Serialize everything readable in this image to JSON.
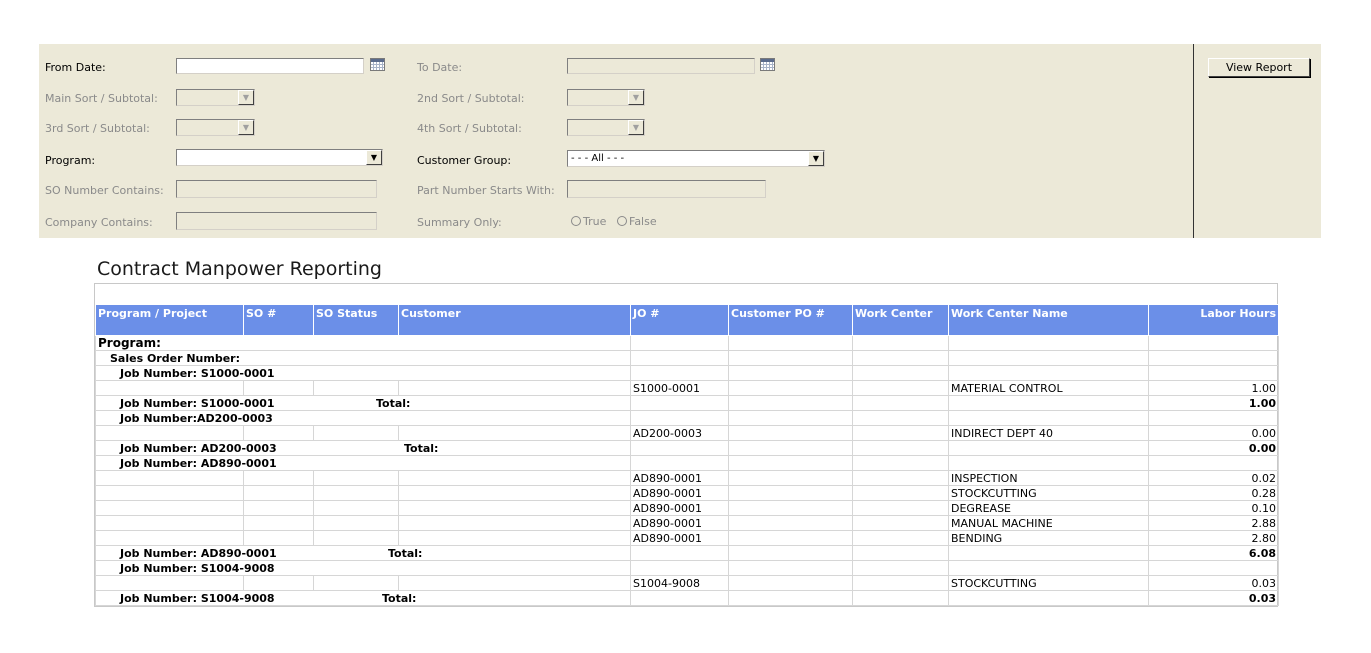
{
  "params": {
    "from_date_label": "From Date:",
    "to_date_label": "To Date:",
    "main_sort_label": "Main Sort / Subtotal:",
    "second_sort_label": "2nd Sort / Subtotal:",
    "third_sort_label": "3rd Sort / Subtotal:",
    "fourth_sort_label": "4th Sort / Subtotal:",
    "program_label": "Program:",
    "customer_group_label": "Customer Group:",
    "customer_group_value": "- - - All - - -",
    "so_number_label": "SO Number Contains:",
    "part_number_label": "Part Number Starts With:",
    "company_label": "Company Contains:",
    "summary_label": "Summary Only:",
    "summary_true": "True",
    "summary_false": "False",
    "view_report": "View Report"
  },
  "report": {
    "title": "Contract Manpower Reporting",
    "columns": [
      "Program / Project",
      "SO #",
      "SO Status",
      "Customer",
      "JO #",
      "Customer PO #",
      "Work Center",
      "Work Center Name",
      "Labor Hours"
    ],
    "program_label": "Program:",
    "sales_order_label": "Sales Order Number:",
    "total_label": "Total:",
    "groups": [
      {
        "header": "Job Number: S1000-0001",
        "footer": "Job Number: S1000-0001",
        "rows": [
          {
            "jo": "S1000-0001",
            "wc_name": "MATERIAL CONTROL",
            "hours": "1.00"
          }
        ],
        "total": "1.00"
      },
      {
        "header": "Job Number:AD200-0003",
        "footer": "Job Number: AD200-0003",
        "rows": [
          {
            "jo": "AD200-0003",
            "wc_name": "INDIRECT DEPT 40",
            "hours": "0.00"
          }
        ],
        "total": "0.00"
      },
      {
        "header": "Job Number: AD890-0001",
        "footer": "Job Number: AD890-0001",
        "rows": [
          {
            "jo": "AD890-0001",
            "wc_name": "INSPECTION",
            "hours": "0.02"
          },
          {
            "jo": "AD890-0001",
            "wc_name": "STOCKCUTTING",
            "hours": "0.28"
          },
          {
            "jo": "AD890-0001",
            "wc_name": "DEGREASE",
            "hours": "0.10"
          },
          {
            "jo": "AD890-0001",
            "wc_name": "MANUAL MACHINE",
            "hours": "2.88"
          },
          {
            "jo": "AD890-0001",
            "wc_name": "BENDING",
            "hours": "2.80"
          }
        ],
        "total": "6.08"
      },
      {
        "header": "Job Number: S1004-9008",
        "footer": "Job Number: S1004-9008",
        "rows": [
          {
            "jo": "S1004-9008",
            "wc_name": "STOCKCUTTING",
            "hours": "0.03"
          }
        ],
        "total": "0.03"
      }
    ]
  }
}
